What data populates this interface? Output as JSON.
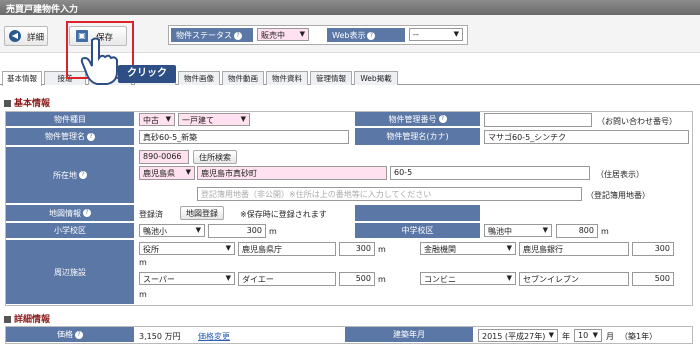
{
  "window": {
    "title": "売買戸建物件入力"
  },
  "toolbar": {
    "detail_label": "詳細",
    "save_label": "保存"
  },
  "status": {
    "label": "物件ステータス",
    "value": "販売中",
    "web_label": "Web表示",
    "web_value": "--"
  },
  "annotation": {
    "click_label": "クリック"
  },
  "tabs": [
    "基本情報",
    "接道",
    "",
    "",
    "物件画像",
    "物件動画",
    "物件資料",
    "管理情報",
    "Web掲載"
  ],
  "basic": {
    "section_title": "基本情報",
    "type_label": "物件種目",
    "type_value1": "中古",
    "type_value2": "一戸建て",
    "mgmt_no_label": "物件管理番号",
    "mgmt_no_note": "（お問い合わせ番号）",
    "name_label": "物件管理名",
    "name_value": "真砂60-5_新築",
    "name_kana_label": "物件管理名(カナ)",
    "name_kana_value": "マサゴ60-5_シンチク",
    "address_label": "所在地",
    "postal": "890-0066",
    "address_search": "住所検索",
    "prefecture": "鹿児島県",
    "city": "鹿児島市真砂町",
    "street": "60-5",
    "address_note": "（住居表示）",
    "reg_placeholder": "登記簿用地番（非公開）※住所は上の番地等に入力してください",
    "reg_note": "（登記簿用地番）",
    "map_label": "地図情報",
    "map_status": "登録済",
    "map_button": "地図登録",
    "map_note": "※保存時に登録されます",
    "elementary_label": "小学校区",
    "elementary_value": "鴨池小",
    "elementary_dist": "300",
    "middle_label": "中学校区",
    "middle_value": "鴨池中",
    "middle_dist": "800",
    "unit_m": "m",
    "nearby_label": "周辺施設",
    "nearby": [
      {
        "category": "役所",
        "name": "鹿児島県庁",
        "dist": "300"
      },
      {
        "category": "金融機関",
        "name": "鹿児島銀行",
        "dist": "300"
      },
      {
        "category": "スーパー",
        "name": "ダイエー",
        "dist": "500"
      },
      {
        "category": "コンビニ",
        "name": "セブンイレブン",
        "dist": "500"
      }
    ]
  },
  "detail": {
    "section_title": "詳細情報",
    "price_label": "価格",
    "price_value": "3,150 万円",
    "price_link": "価格変更",
    "built_label": "建築年月",
    "built_year": "2015 (平成27年)",
    "year_unit": "年",
    "built_month": "10",
    "month_unit": "月",
    "age": "（築1年）"
  },
  "colors": {
    "label_bg": "#5b77a6",
    "highlight": "#d9242b",
    "required": "#ffe1ef",
    "click_badge": "#2d4f86"
  }
}
